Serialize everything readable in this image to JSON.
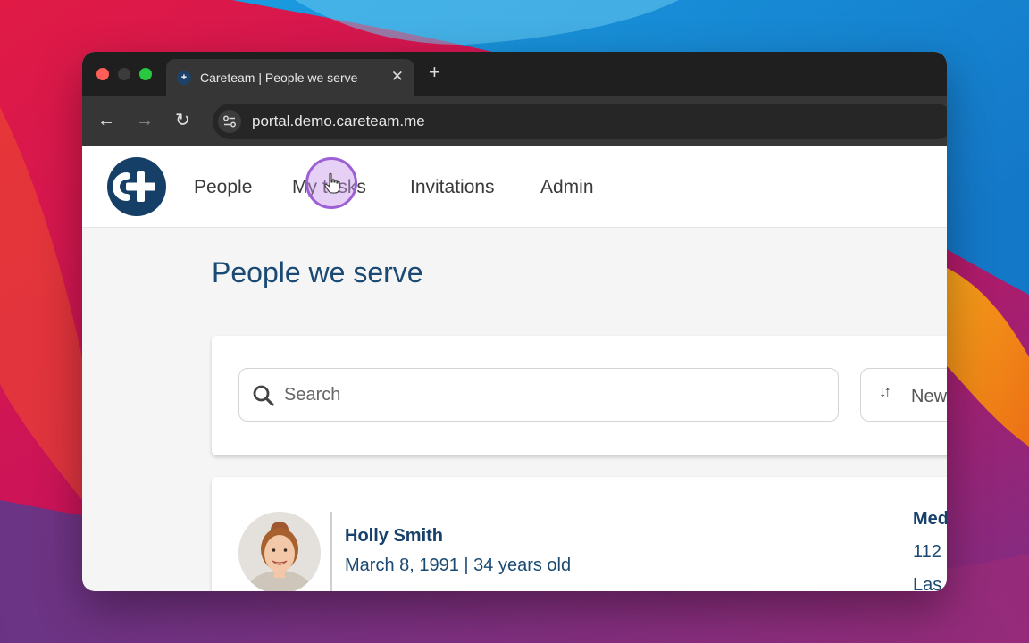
{
  "browser": {
    "tab_title": "Careteam | People we serve",
    "tab_close": "✕",
    "new_tab": "+",
    "url": "portal.demo.careteam.me",
    "nav_back": "←",
    "nav_forward": "→",
    "nav_reload": "↻"
  },
  "header": {
    "logo_icon": "careteam-cross-logo",
    "nav": [
      {
        "label": "People"
      },
      {
        "label": "My tasks"
      },
      {
        "label": "Invitations"
      },
      {
        "label": "Admin"
      }
    ]
  },
  "main": {
    "title": "People we serve",
    "search": {
      "placeholder": "Search",
      "value": "",
      "icon": "search-icon"
    },
    "sort": {
      "icon": "sort-arrows-icon",
      "label": "New"
    }
  },
  "people": [
    {
      "name": "Holly Smith",
      "dob_age": "March 8, 1991 | 34 years old",
      "side_heading": "Med",
      "side_line1": "112",
      "side_line2": "Las"
    }
  ],
  "colors": {
    "brand_navy": "#153f66",
    "heading_blue": "#1a4a73",
    "cursor_highlight": "#9d5fd6"
  }
}
